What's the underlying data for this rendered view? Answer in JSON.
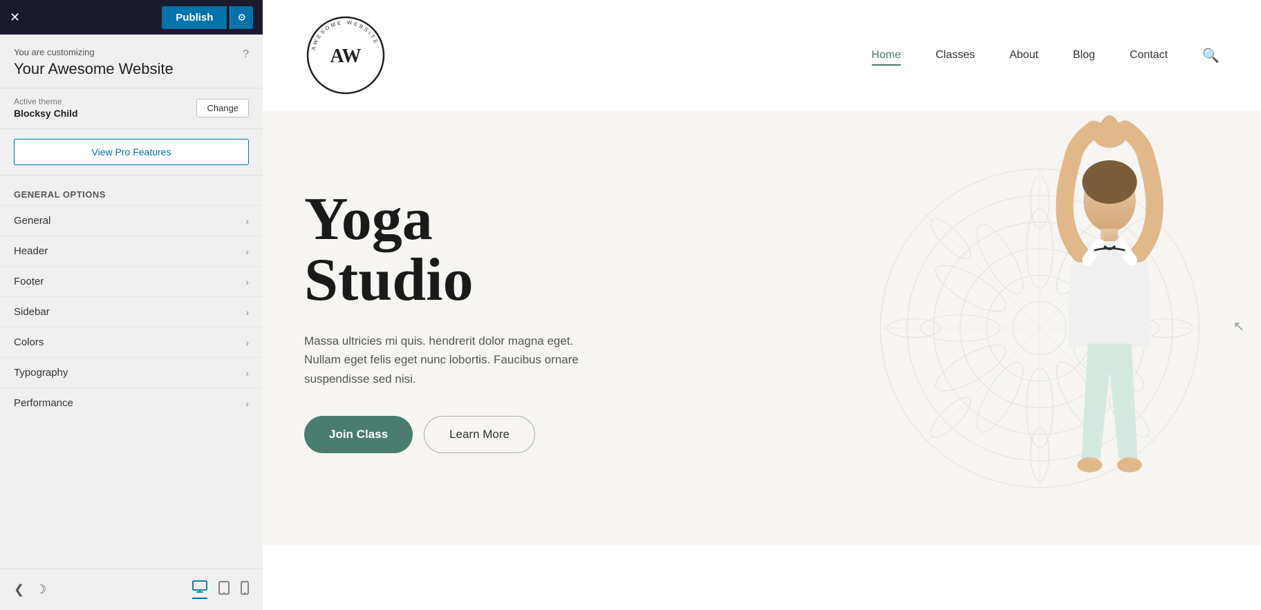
{
  "topbar": {
    "close_icon": "✕",
    "publish_label": "Publish",
    "settings_icon": "⚙"
  },
  "customizer": {
    "sub_title": "You are customizing",
    "site_title": "Your Awesome Website",
    "help_icon": "?",
    "theme_label": "Active theme",
    "theme_name": "Blocksy Child",
    "change_label": "Change",
    "pro_features_label": "View Pro Features",
    "general_options_label": "General Options",
    "menu_items": [
      {
        "label": "General",
        "id": "general"
      },
      {
        "label": "Header",
        "id": "header"
      },
      {
        "label": "Footer",
        "id": "footer"
      },
      {
        "label": "Sidebar",
        "id": "sidebar"
      },
      {
        "label": "Colors",
        "id": "colors"
      },
      {
        "label": "Typography",
        "id": "typography"
      },
      {
        "label": "Performance",
        "id": "performance"
      }
    ]
  },
  "bottom_bar": {
    "back_arrow": "❮",
    "moon_icon": "☽",
    "desktop_icon": "🖥",
    "tablet_icon": "⬜",
    "mobile_icon": "📱"
  },
  "preview": {
    "nav_items": [
      {
        "label": "Home",
        "active": true
      },
      {
        "label": "Classes",
        "active": false
      },
      {
        "label": "About",
        "active": false
      },
      {
        "label": "Blog",
        "active": false
      },
      {
        "label": "Contact",
        "active": false
      }
    ],
    "hero_title_line1": "Yoga",
    "hero_title_line2": "Studio",
    "hero_subtitle": "Massa ultricies mi quis. hendrerit dolor magna eget. Nullam eget felis eget nunc lobortis. Faucibus ornare suspendisse sed nisi.",
    "btn_join": "Join Class",
    "btn_learn": "Learn More"
  }
}
